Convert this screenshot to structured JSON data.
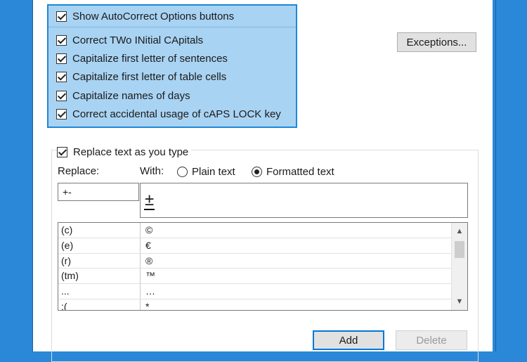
{
  "options": [
    {
      "text": "Show AutoCorrect Options buttons",
      "checked": true
    },
    {
      "text": "Correct TWo INitial CApitals",
      "checked": true
    },
    {
      "text": "Capitalize first letter of sentences",
      "checked": true
    },
    {
      "text": "Capitalize first letter of table cells",
      "checked": true
    },
    {
      "text": "Capitalize names of days",
      "checked": true
    },
    {
      "text": "Correct accidental usage of cAPS LOCK key",
      "checked": true
    }
  ],
  "exceptions_button": "Exceptions...",
  "replace_group": {
    "title": "Replace text as you type",
    "checked": true,
    "replace_label": "Replace:",
    "with_label": "With:",
    "plain_text_label": "Plain text",
    "formatted_text_label": "Formatted text",
    "selected_mode": "formatted",
    "replace_value": "+-",
    "with_value": "±"
  },
  "entries": [
    {
      "replace": "(c)",
      "with": "©"
    },
    {
      "replace": "(e)",
      "with": "€"
    },
    {
      "replace": "(r)",
      "with": "®"
    },
    {
      "replace": "(tm)",
      "with": "™"
    },
    {
      "replace": "...",
      "with": "…"
    },
    {
      "replace": ":(",
      "with": "*"
    }
  ],
  "buttons": {
    "add": "Add",
    "delete": "Delete"
  },
  "colors": {
    "highlight": "#a9d3f3",
    "highlight_border": "#1e88d6",
    "window_bg": "#2b88d8"
  }
}
